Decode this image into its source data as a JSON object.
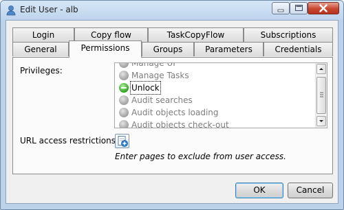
{
  "window": {
    "title": "Edit User - alb",
    "controls": {
      "minimize": "minimize",
      "maximize": "maximize",
      "close": "close"
    }
  },
  "tabs": {
    "row_top": [
      "Login",
      "Copy flow",
      "TaskCopyFlow",
      "Subscriptions"
    ],
    "row_bottom": [
      "General",
      "Permissions",
      "Groups",
      "Parameters",
      "Credentials"
    ],
    "active": "Permissions"
  },
  "permissions": {
    "privileges_label": "Privileges:",
    "privileges": [
      {
        "label": "Manage UI",
        "state": "off"
      },
      {
        "label": "Manage Tasks",
        "state": "off"
      },
      {
        "label": "Unlock",
        "state": "on"
      },
      {
        "label": "Audit searches",
        "state": "off"
      },
      {
        "label": "Audit objects loading",
        "state": "off"
      },
      {
        "label": "Audit objects check-out",
        "state": "off"
      }
    ],
    "url_label": "URL access restrictions:",
    "url_hint": "Enter pages to exclude from user access."
  },
  "buttons": {
    "ok": "OK",
    "cancel": "Cancel"
  },
  "colors": {
    "frame": "#bcd2e8",
    "accent_on": "#3dae2a",
    "close": "#c7452f"
  }
}
